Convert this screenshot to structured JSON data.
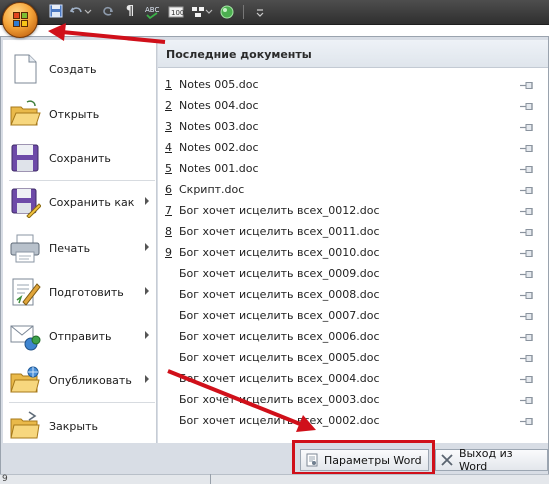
{
  "toolbar": {
    "icons": [
      "save-icon",
      "undo-icon",
      "redo-icon",
      "pilcrow-icon",
      "spelling-icon",
      "caption-icon",
      "arrange-icon",
      "orb-icon",
      "customize-icon"
    ]
  },
  "orb": {
    "icon": "office-logo-icon"
  },
  "commands": [
    {
      "label": "Создать",
      "icon": "new-document-icon",
      "submenu": false
    },
    {
      "label": "Открыть",
      "icon": "open-folder-icon",
      "submenu": false
    },
    {
      "label": "Сохранить",
      "icon": "save-icon",
      "submenu": false
    },
    {
      "label": "Сохранить как",
      "icon": "save-as-icon",
      "submenu": true
    },
    {
      "label": "Печать",
      "icon": "print-icon",
      "submenu": true
    },
    {
      "label": "Подготовить",
      "icon": "prepare-icon",
      "submenu": true
    },
    {
      "label": "Отправить",
      "icon": "send-icon",
      "submenu": true
    },
    {
      "label": "Опубликовать",
      "icon": "publish-icon",
      "submenu": true
    },
    {
      "label": "Закрыть",
      "icon": "close-folder-icon",
      "submenu": false
    }
  ],
  "recent": {
    "title": "Последние документы",
    "documents": [
      {
        "num": "1",
        "name": "Notes 005.doc"
      },
      {
        "num": "2",
        "name": "Notes 004.doc"
      },
      {
        "num": "3",
        "name": "Notes 003.doc"
      },
      {
        "num": "4",
        "name": "Notes 002.doc"
      },
      {
        "num": "5",
        "name": "Notes 001.doc"
      },
      {
        "num": "6",
        "name": "Скрипт.doc"
      },
      {
        "num": "7",
        "name": "Бог хочет исцелить всех_0012.doc"
      },
      {
        "num": "8",
        "name": "Бог хочет исцелить всех_0011.doc"
      },
      {
        "num": "9",
        "name": "Бог хочет исцелить всех_0010.doc"
      },
      {
        "num": "",
        "name": "Бог хочет исцелить всех_0009.doc"
      },
      {
        "num": "",
        "name": "Бог хочет исцелить всех_0008.doc"
      },
      {
        "num": "",
        "name": "Бог хочет исцелить всех_0007.doc"
      },
      {
        "num": "",
        "name": "Бог хочет исцелить всех_0006.doc"
      },
      {
        "num": "",
        "name": "Бог хочет исцелить всех_0005.doc"
      },
      {
        "num": "",
        "name": "Бог хочет исцелить всех_0004.doc"
      },
      {
        "num": "",
        "name": "Бог хочет исцелить всех_0003.doc"
      },
      {
        "num": "",
        "name": "Бог хочет исцелить всех_0002.doc"
      }
    ]
  },
  "footer": {
    "options_label": "Параметры Word",
    "exit_label": "Выход из Word"
  },
  "ruler": {
    "mark": "9"
  },
  "colors": {
    "annotation": "#d0101a",
    "menu_bg": "#d8dde5"
  }
}
